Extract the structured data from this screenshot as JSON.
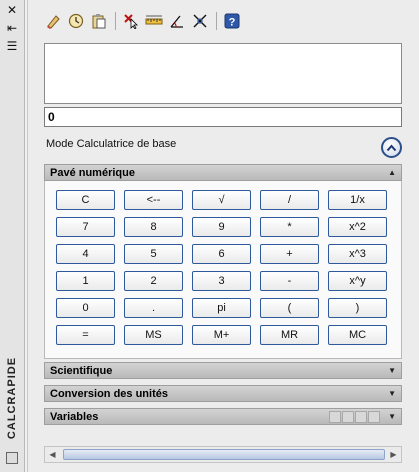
{
  "palette": {
    "title": "CALCRAPIDE",
    "close_glyph": "✕",
    "autohide_glyph": "⇤",
    "properties_glyph": "☰"
  },
  "toolbar": {
    "icons": [
      "eraser-icon",
      "clock-icon",
      "paste-icon",
      "get-coordinates-icon",
      "distance-icon",
      "angle-icon",
      "intersection-icon",
      "help-icon"
    ]
  },
  "display": {
    "history": "",
    "value": "0"
  },
  "mode": {
    "label": "Mode Calculatrice de base"
  },
  "sections": {
    "numpad": "Pavé numérique",
    "scientific": "Scientifique",
    "units": "Conversion des unités",
    "variables": "Variables"
  },
  "keypad": [
    [
      "C",
      "<--",
      "√",
      "/",
      "1/x"
    ],
    [
      "7",
      "8",
      "9",
      "*",
      "x^2"
    ],
    [
      "4",
      "5",
      "6",
      "+",
      "x^3"
    ],
    [
      "1",
      "2",
      "3",
      "-",
      "x^y"
    ],
    [
      "0",
      ".",
      "pi",
      "(",
      ")"
    ],
    [
      "=",
      "MS",
      "M+",
      "MR",
      "MC"
    ]
  ],
  "colors": {
    "key_border": "#2e5a9b",
    "help_blue": "#2f58a8",
    "toggle_blue": "#2d4f89"
  }
}
